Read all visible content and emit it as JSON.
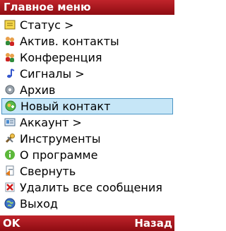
{
  "title": "Главное меню",
  "menu": {
    "items": [
      {
        "label": "Статус >",
        "icon": "status-icon"
      },
      {
        "label": "Актив. контакты",
        "icon": "active-contacts-icon"
      },
      {
        "label": "Конференция",
        "icon": "conference-icon"
      },
      {
        "label": "Сигналы >",
        "icon": "music-note-icon"
      },
      {
        "label": "Архив",
        "icon": "archive-icon"
      },
      {
        "label": "Новый контакт",
        "icon": "new-contact-icon",
        "selected": true
      },
      {
        "label": "Аккаунт >",
        "icon": "account-icon"
      },
      {
        "label": "Инструменты",
        "icon": "tools-icon"
      },
      {
        "label": "О программе",
        "icon": "info-icon"
      },
      {
        "label": "Свернуть",
        "icon": "minimize-icon"
      },
      {
        "label": "Удалить все сообщения",
        "icon": "delete-icon"
      },
      {
        "label": "Выход",
        "icon": "exit-globe-icon"
      }
    ]
  },
  "softkeys": {
    "left": "OK",
    "right": "Назад"
  },
  "colors": {
    "bar": "#a8161c",
    "selection": "#c6e6f7",
    "selection_border": "#4a94c4"
  }
}
